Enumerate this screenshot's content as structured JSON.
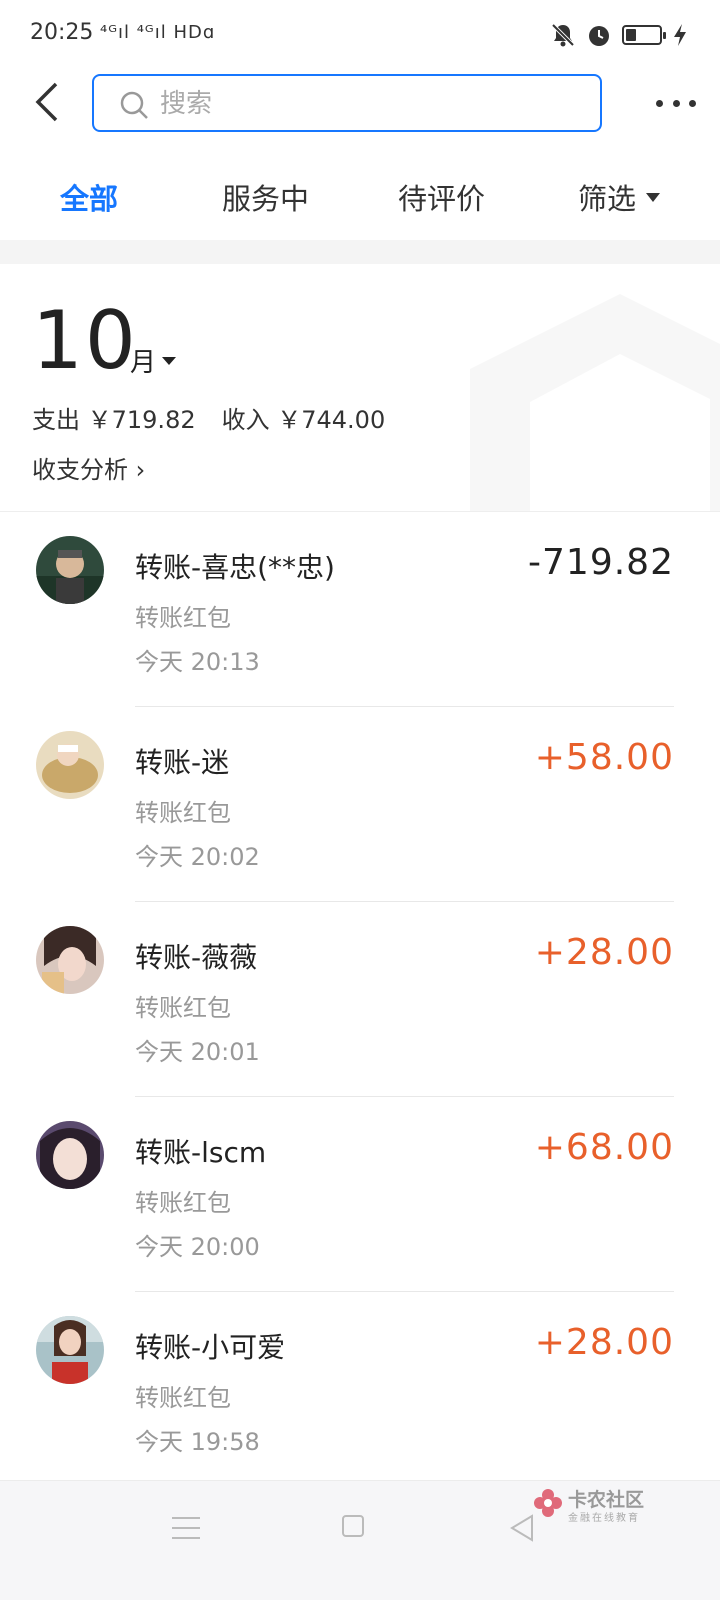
{
  "status_bar": {
    "time": "20:25",
    "network": "⁴ᴳıl ⁴ᴳıl HDɑ"
  },
  "header": {
    "search_placeholder": "搜索"
  },
  "tabs": [
    {
      "label": "全部",
      "active": true
    },
    {
      "label": "服务中",
      "active": false
    },
    {
      "label": "待评价",
      "active": false
    },
    {
      "label": "筛选",
      "active": false
    }
  ],
  "summary": {
    "month": "10",
    "month_unit": "月",
    "expense_label": "支出 ￥719.82",
    "income_label": "收入 ￥744.00",
    "analysis_label": "收支分析 ›"
  },
  "transactions": [
    {
      "title": "转账-喜忠(**忠)",
      "category": "转账红包",
      "time": "今天  20:13",
      "amount": "-719.82",
      "type": "expense"
    },
    {
      "title": "转账-迷",
      "category": "转账红包",
      "time": "今天  20:02",
      "amount": "+58.00",
      "type": "income"
    },
    {
      "title": "转账-薇薇",
      "category": "转账红包",
      "time": "今天  20:01",
      "amount": "+28.00",
      "type": "income"
    },
    {
      "title": "转账-lscm",
      "category": "转账红包",
      "time": "今天  20:00",
      "amount": "+68.00",
      "type": "income"
    },
    {
      "title": "转账-小可爱",
      "category": "转账红包",
      "time": "今天  19:58",
      "amount": "+28.00",
      "type": "income"
    }
  ],
  "watermark": {
    "name": "卡农社区",
    "tagline": "金融在线教育"
  },
  "colors": {
    "accent": "#1677ff",
    "income": "#e8602b",
    "text_primary": "#222222",
    "text_secondary": "#999999"
  }
}
